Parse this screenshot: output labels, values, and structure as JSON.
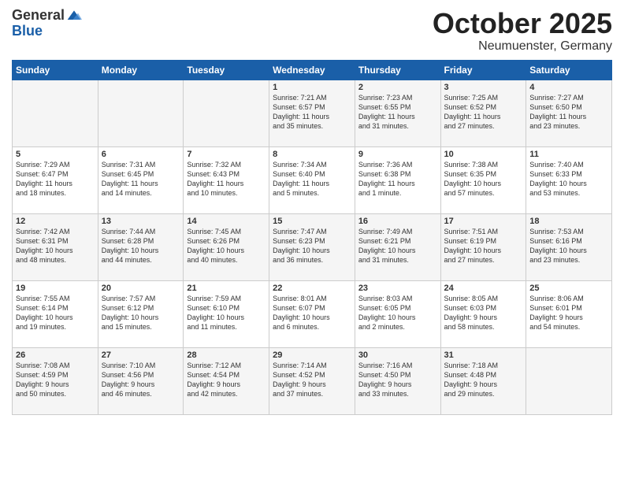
{
  "logo": {
    "general": "General",
    "blue": "Blue"
  },
  "title": "October 2025",
  "subtitle": "Neumuenster, Germany",
  "days_header": [
    "Sunday",
    "Monday",
    "Tuesday",
    "Wednesday",
    "Thursday",
    "Friday",
    "Saturday"
  ],
  "weeks": [
    [
      {
        "day": "",
        "info": ""
      },
      {
        "day": "",
        "info": ""
      },
      {
        "day": "",
        "info": ""
      },
      {
        "day": "1",
        "info": "Sunrise: 7:21 AM\nSunset: 6:57 PM\nDaylight: 11 hours\nand 35 minutes."
      },
      {
        "day": "2",
        "info": "Sunrise: 7:23 AM\nSunset: 6:55 PM\nDaylight: 11 hours\nand 31 minutes."
      },
      {
        "day": "3",
        "info": "Sunrise: 7:25 AM\nSunset: 6:52 PM\nDaylight: 11 hours\nand 27 minutes."
      },
      {
        "day": "4",
        "info": "Sunrise: 7:27 AM\nSunset: 6:50 PM\nDaylight: 11 hours\nand 23 minutes."
      }
    ],
    [
      {
        "day": "5",
        "info": "Sunrise: 7:29 AM\nSunset: 6:47 PM\nDaylight: 11 hours\nand 18 minutes."
      },
      {
        "day": "6",
        "info": "Sunrise: 7:31 AM\nSunset: 6:45 PM\nDaylight: 11 hours\nand 14 minutes."
      },
      {
        "day": "7",
        "info": "Sunrise: 7:32 AM\nSunset: 6:43 PM\nDaylight: 11 hours\nand 10 minutes."
      },
      {
        "day": "8",
        "info": "Sunrise: 7:34 AM\nSunset: 6:40 PM\nDaylight: 11 hours\nand 5 minutes."
      },
      {
        "day": "9",
        "info": "Sunrise: 7:36 AM\nSunset: 6:38 PM\nDaylight: 11 hours\nand 1 minute."
      },
      {
        "day": "10",
        "info": "Sunrise: 7:38 AM\nSunset: 6:35 PM\nDaylight: 10 hours\nand 57 minutes."
      },
      {
        "day": "11",
        "info": "Sunrise: 7:40 AM\nSunset: 6:33 PM\nDaylight: 10 hours\nand 53 minutes."
      }
    ],
    [
      {
        "day": "12",
        "info": "Sunrise: 7:42 AM\nSunset: 6:31 PM\nDaylight: 10 hours\nand 48 minutes."
      },
      {
        "day": "13",
        "info": "Sunrise: 7:44 AM\nSunset: 6:28 PM\nDaylight: 10 hours\nand 44 minutes."
      },
      {
        "day": "14",
        "info": "Sunrise: 7:45 AM\nSunset: 6:26 PM\nDaylight: 10 hours\nand 40 minutes."
      },
      {
        "day": "15",
        "info": "Sunrise: 7:47 AM\nSunset: 6:23 PM\nDaylight: 10 hours\nand 36 minutes."
      },
      {
        "day": "16",
        "info": "Sunrise: 7:49 AM\nSunset: 6:21 PM\nDaylight: 10 hours\nand 31 minutes."
      },
      {
        "day": "17",
        "info": "Sunrise: 7:51 AM\nSunset: 6:19 PM\nDaylight: 10 hours\nand 27 minutes."
      },
      {
        "day": "18",
        "info": "Sunrise: 7:53 AM\nSunset: 6:16 PM\nDaylight: 10 hours\nand 23 minutes."
      }
    ],
    [
      {
        "day": "19",
        "info": "Sunrise: 7:55 AM\nSunset: 6:14 PM\nDaylight: 10 hours\nand 19 minutes."
      },
      {
        "day": "20",
        "info": "Sunrise: 7:57 AM\nSunset: 6:12 PM\nDaylight: 10 hours\nand 15 minutes."
      },
      {
        "day": "21",
        "info": "Sunrise: 7:59 AM\nSunset: 6:10 PM\nDaylight: 10 hours\nand 11 minutes."
      },
      {
        "day": "22",
        "info": "Sunrise: 8:01 AM\nSunset: 6:07 PM\nDaylight: 10 hours\nand 6 minutes."
      },
      {
        "day": "23",
        "info": "Sunrise: 8:03 AM\nSunset: 6:05 PM\nDaylight: 10 hours\nand 2 minutes."
      },
      {
        "day": "24",
        "info": "Sunrise: 8:05 AM\nSunset: 6:03 PM\nDaylight: 9 hours\nand 58 minutes."
      },
      {
        "day": "25",
        "info": "Sunrise: 8:06 AM\nSunset: 6:01 PM\nDaylight: 9 hours\nand 54 minutes."
      }
    ],
    [
      {
        "day": "26",
        "info": "Sunrise: 7:08 AM\nSunset: 4:59 PM\nDaylight: 9 hours\nand 50 minutes."
      },
      {
        "day": "27",
        "info": "Sunrise: 7:10 AM\nSunset: 4:56 PM\nDaylight: 9 hours\nand 46 minutes."
      },
      {
        "day": "28",
        "info": "Sunrise: 7:12 AM\nSunset: 4:54 PM\nDaylight: 9 hours\nand 42 minutes."
      },
      {
        "day": "29",
        "info": "Sunrise: 7:14 AM\nSunset: 4:52 PM\nDaylight: 9 hours\nand 37 minutes."
      },
      {
        "day": "30",
        "info": "Sunrise: 7:16 AM\nSunset: 4:50 PM\nDaylight: 9 hours\nand 33 minutes."
      },
      {
        "day": "31",
        "info": "Sunrise: 7:18 AM\nSunset: 4:48 PM\nDaylight: 9 hours\nand 29 minutes."
      },
      {
        "day": "",
        "info": ""
      }
    ]
  ]
}
